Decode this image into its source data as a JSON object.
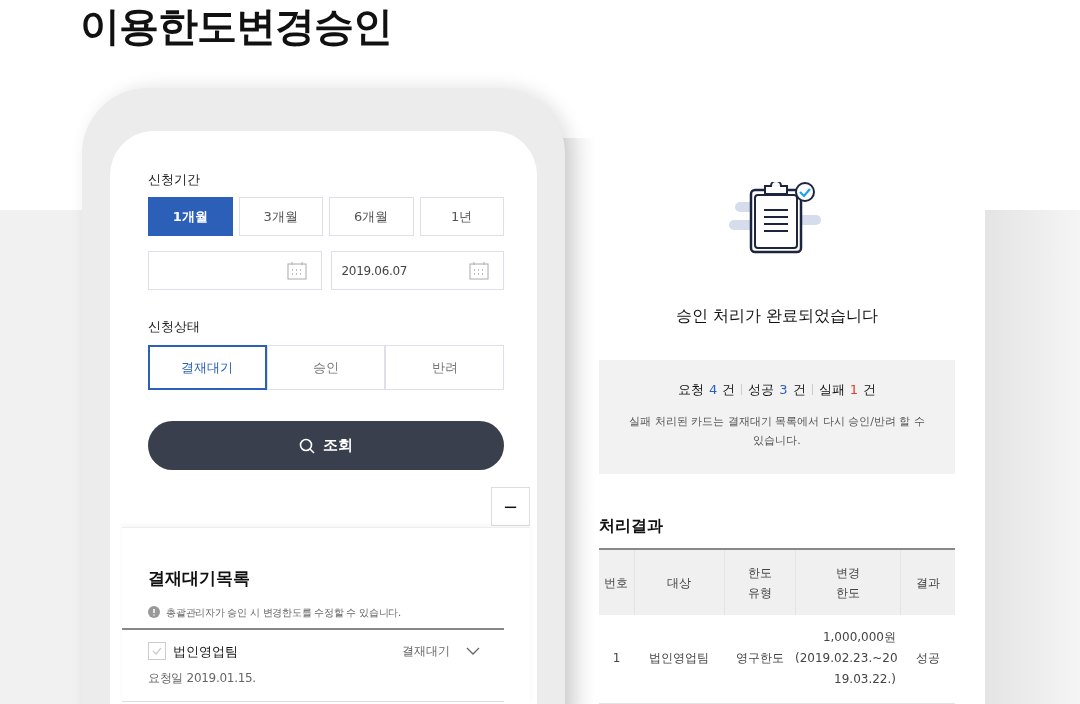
{
  "page_title": "이용한도변경승인",
  "phone": {
    "period": {
      "label": "신청기간",
      "options": [
        {
          "label": "1개월",
          "selected": true
        },
        {
          "label": "3개월",
          "selected": false
        },
        {
          "label": "6개월",
          "selected": false
        },
        {
          "label": "1년",
          "selected": false
        }
      ],
      "date_to": "2019.06.07"
    },
    "status": {
      "label": "신청상태",
      "options": [
        {
          "label": "결재대기",
          "selected": true
        },
        {
          "label": "승인",
          "selected": false
        },
        {
          "label": "반려",
          "selected": false
        }
      ]
    },
    "search_button": "조회",
    "collapse_button": "−",
    "list": {
      "title": "결재대기목록",
      "note": "총괄관리자가 승인 시 변경한도를 수정할 수 있습니다.",
      "items": [
        {
          "name": "법인영업팀",
          "checked": false,
          "status": "결재대기",
          "date": "요청일 2019.01.15."
        }
      ]
    }
  },
  "result": {
    "message": "승인 처리가 완료되었습니다",
    "counts": [
      {
        "label": "요청",
        "count": "4",
        "unit": "건",
        "color": "#2b5fb8"
      },
      {
        "label": "성공",
        "count": "3",
        "unit": "건",
        "color": "#2b5fb8"
      },
      {
        "label": "실패",
        "count": "1",
        "unit": "건",
        "color": "#e53935"
      }
    ],
    "note": "실패 처리된 카드는 결재대기 목록에서 다시 승인/반려 할 수 있습니다.",
    "table_title": "처리결과",
    "columns": [
      "번호",
      "대상",
      "한도\n유형",
      "변경\n한도",
      "결과"
    ],
    "rows": [
      [
        "1",
        "법인영업팀",
        "영구한도",
        "1,000,000원\n(2019.02.23.~20\n19.03.22.)",
        "성공"
      ]
    ]
  }
}
